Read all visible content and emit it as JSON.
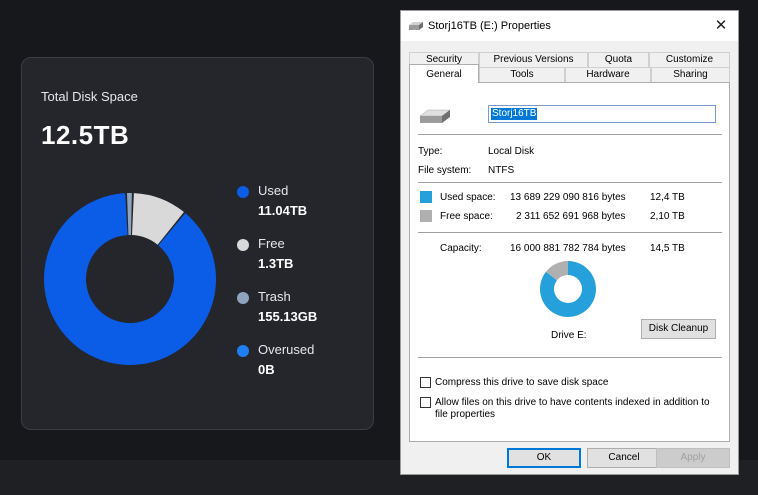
{
  "card": {
    "title": "Total Disk Space",
    "total": "12.5TB",
    "legend": [
      {
        "label": "Used",
        "value": "11.04TB",
        "color": "#0b5ce6"
      },
      {
        "label": "Free",
        "value": "1.3TB",
        "color": "#d9d9d9"
      },
      {
        "label": "Trash",
        "value": "155.13GB",
        "color": "#8fa4bd"
      },
      {
        "label": "Overused",
        "value": "0B",
        "color": "#1f7ff2"
      }
    ],
    "donut": [
      {
        "label": "Used",
        "fraction": 0.8832,
        "color": "#0b5ce6"
      },
      {
        "label": "Free",
        "fraction": 0.104,
        "color": "#d9d9d9"
      },
      {
        "label": "Trash",
        "fraction": 0.0124,
        "color": "#8fa4bd"
      }
    ]
  },
  "dialog": {
    "title": "Storj16TB (E:) Properties",
    "close": "✕",
    "tabs_row1": [
      "Security",
      "Previous Versions",
      "Quota",
      "Customize"
    ],
    "tabs_row2": [
      "General",
      "Tools",
      "Hardware",
      "Sharing"
    ],
    "active_tab": "General",
    "drive_name": "Storj16TB",
    "type_label": "Type:",
    "type_value": "Local Disk",
    "fs_label": "File system:",
    "fs_value": "NTFS",
    "used_label": "Used space:",
    "used_bytes": "13 689 229 090 816 bytes",
    "used_size": "12,4 TB",
    "free_label": "Free space:",
    "free_bytes": "2 311 652 691 968 bytes",
    "free_size": "2,10 TB",
    "capacity_label": "Capacity:",
    "capacity_bytes": "16 000 881 782 784 bytes",
    "capacity_size": "14,5 TB",
    "drive_label": "Drive E:",
    "cleanup_button": "Disk Cleanup",
    "compress_label": "Compress this drive to save disk space",
    "index_label_1": "Allow files on this drive to have contents indexed in addition to",
    "index_label_2": "file properties",
    "ok_button": "OK",
    "cancel_button": "Cancel",
    "apply_button": "Apply",
    "used_color": "#26a0da",
    "free_color": "#b0b0b0",
    "pie": [
      {
        "label": "Used space",
        "fraction": 0.8555,
        "color": "#26a0da"
      },
      {
        "label": "Free space",
        "fraction": 0.1445,
        "color": "#b0b0b0"
      }
    ]
  }
}
